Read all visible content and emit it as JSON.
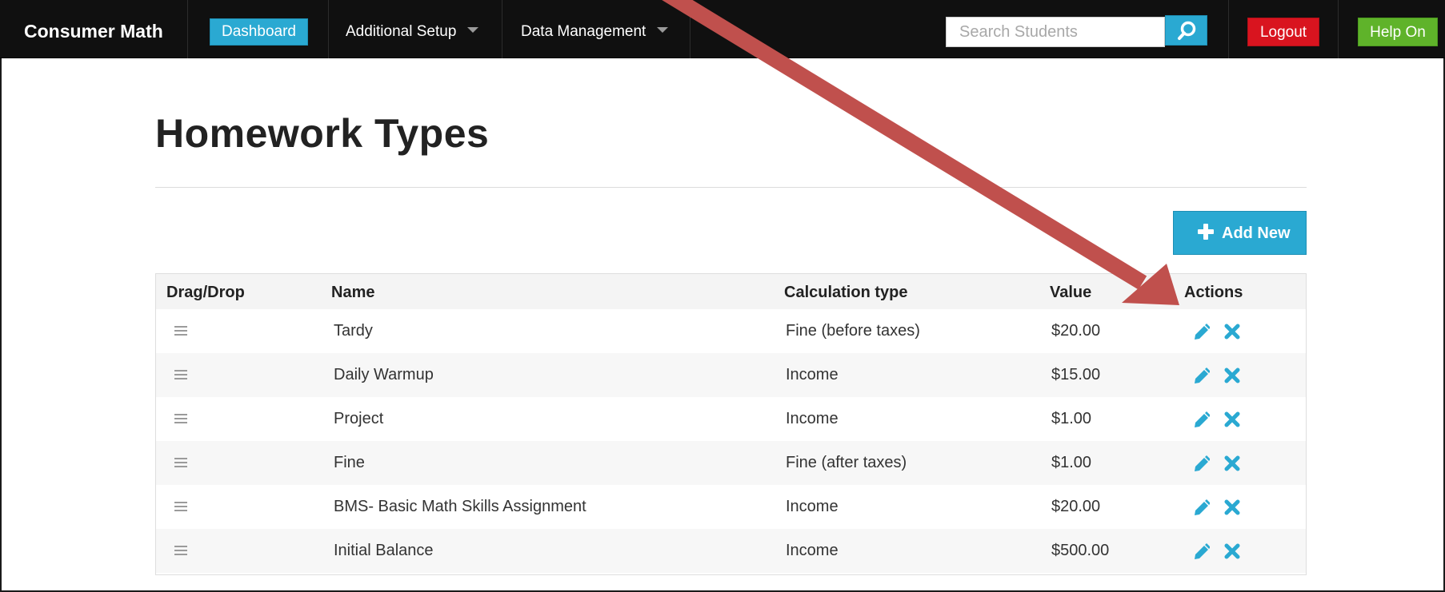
{
  "navbar": {
    "brand": "Consumer Math",
    "dashboard_label": "Dashboard",
    "additional_setup_label": "Additional Setup",
    "data_management_label": "Data Management",
    "search_placeholder": "Search Students",
    "search_icon": "search-icon",
    "logout_label": "Logout",
    "help_label": "Help On",
    "colors": {
      "bar": "#101010",
      "dashboard": "#2aa9d2",
      "logout": "#d9141f",
      "help": "#5fb32a"
    }
  },
  "page": {
    "title": "Homework Types",
    "add_new_label": "Add New",
    "add_icon": "plus-icon"
  },
  "table": {
    "headers": {
      "drag": "Drag/Drop",
      "name": "Name",
      "calc": "Calculation type",
      "value": "Value",
      "actions": "Actions"
    },
    "rows": [
      {
        "name": "Tardy",
        "calc": "Fine (before taxes)",
        "value": "$20.00"
      },
      {
        "name": "Daily Warmup",
        "calc": "Income",
        "value": "$15.00"
      },
      {
        "name": "Project",
        "calc": "Income",
        "value": "$1.00"
      },
      {
        "name": "Fine",
        "calc": "Fine (after taxes)",
        "value": "$1.00"
      },
      {
        "name": "BMS- Basic Math Skills Assignment",
        "calc": "Income",
        "value": "$20.00"
      },
      {
        "name": "Initial Balance",
        "calc": "Income",
        "value": "$500.00"
      }
    ],
    "row_icons": {
      "drag": "drag-handle-icon",
      "edit": "pencil-icon",
      "delete": "close-icon"
    }
  },
  "annotation": {
    "arrow_color": "#c0504d"
  }
}
